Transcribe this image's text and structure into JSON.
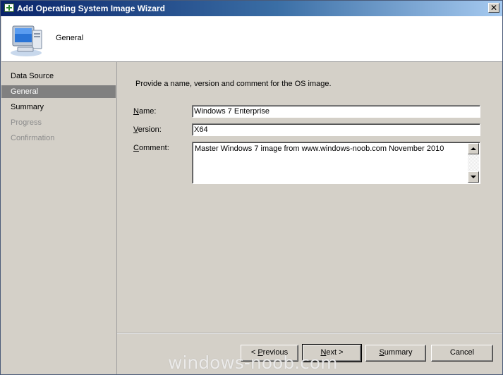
{
  "window": {
    "title": "Add Operating System Image Wizard",
    "close_glyph": "✕"
  },
  "header": {
    "heading": "General",
    "icon": "computer-icon"
  },
  "sidebar": {
    "items": [
      {
        "label": "Data Source",
        "state": "normal"
      },
      {
        "label": "General",
        "state": "active"
      },
      {
        "label": "Summary",
        "state": "normal"
      },
      {
        "label": "Progress",
        "state": "disabled"
      },
      {
        "label": "Confirmation",
        "state": "disabled"
      }
    ]
  },
  "form": {
    "intro": "Provide a name, version and comment for the OS image.",
    "name": {
      "label_mnemonic": "N",
      "label_rest": "ame:",
      "value": "Windows 7 Enterprise"
    },
    "version": {
      "label_mnemonic": "V",
      "label_rest": "ersion:",
      "value": "X64"
    },
    "comment": {
      "label_mnemonic": "C",
      "label_rest": "omment:",
      "value": "Master Windows 7 image from www.windows-noob.com November 2010"
    }
  },
  "buttons": {
    "previous": {
      "prefix": "< ",
      "mnemonic": "P",
      "rest": "revious"
    },
    "next": {
      "mnemonic": "N",
      "rest": "ext >"
    },
    "summary": {
      "mnemonic": "S",
      "rest": "ummary"
    },
    "cancel": {
      "label": "Cancel"
    }
  },
  "watermark": "windows-noob.com",
  "colors": {
    "titlebar_start": "#0a246a",
    "titlebar_end": "#a6caf0",
    "face": "#d4d0c8",
    "nav_active": "#808080"
  }
}
